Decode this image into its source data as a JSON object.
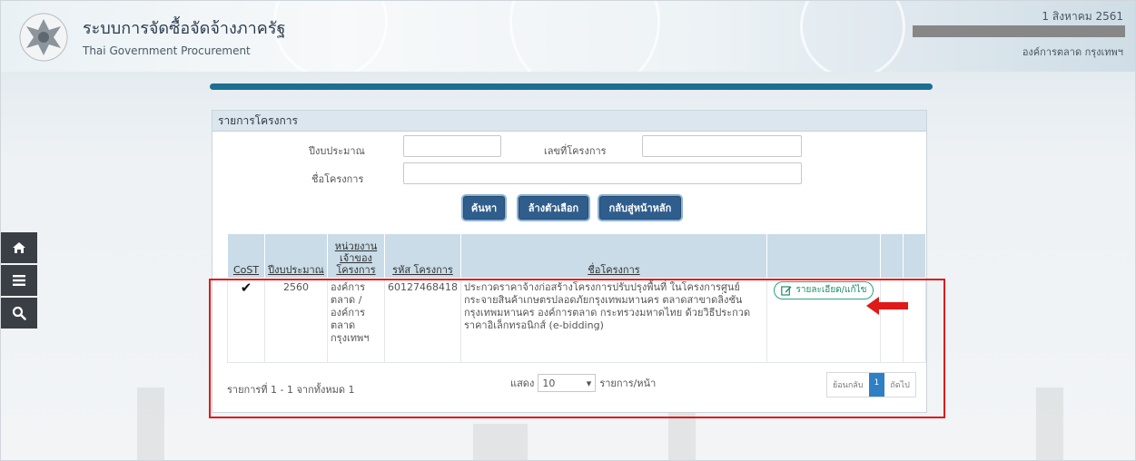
{
  "header": {
    "title": "ระบบการจัดซื้อจัดจ้างภาครัฐ",
    "subtitle": "Thai Government Procurement",
    "date": "1 สิงหาคม 2561",
    "org": "องค์การตลาด กรุงเทพฯ",
    "emblem_icon": "garuda-emblem-icon"
  },
  "sidebar": {
    "items": [
      {
        "icon": "home-icon"
      },
      {
        "icon": "menu-icon"
      },
      {
        "icon": "search-icon"
      }
    ]
  },
  "panel": {
    "title": "รายการโครงการ",
    "search": {
      "fiscal_year_label": "ปีงบประมาณ",
      "fiscal_year_value": "",
      "project_no_label": "เลขที่โครงการ",
      "project_no_value": "",
      "project_name_label": "ชื่อโครงการ",
      "project_name_value": ""
    },
    "buttons": {
      "search": "ค้นหา",
      "clear": "ล้างตัวเลือก",
      "home": "กลับสู่หน้าหลัก"
    },
    "table": {
      "headers": {
        "cost": "CoST",
        "fiscal_year": "ปีงบประมาณ",
        "agency": "หน่วยงาน เจ้าของ โครงการ",
        "project_id": "รหัส โครงการ",
        "project_name": "ชื่อโครงการ"
      },
      "rows": [
        {
          "cost": "✔",
          "fiscal_year": "2560",
          "agency": "องค์การ ตลาด / องค์การ ตลาด กรุงเทพฯ",
          "project_id": "60127468418",
          "project_name": "ประกวดราคาจ้างก่อสร้างโครงการปรับปรุงพื้นที่ ในโครงการศูนย์กระจายสินค้าเกษตรปลอดภัยกรุงเทพมหานคร ตลาดสาขาดลิ่งชัน กรุงเทพมหานคร องค์การตลาด กระทรวงมหาดไทย ด้วยวิธีประกวดราคาอิเล็กทรอนิกส์ (e-bidding)",
          "action": "รายละเอียด/แก้ไข"
        }
      ]
    },
    "footer": {
      "summary": "รายการที่ 1 - 1 จากทั้งหมด 1",
      "show_label": "แสดง",
      "page_size": "10",
      "per_page_label": "รายการ/หน้า",
      "prev": "ย้อนกลับ",
      "current_page": "1",
      "next": "ถัดไป"
    }
  },
  "colors": {
    "accent_bar": "#1d6f8f",
    "button_blue": "#2f5d8c",
    "highlight_red": "#e01919",
    "detail_green": "#1f8c66"
  }
}
